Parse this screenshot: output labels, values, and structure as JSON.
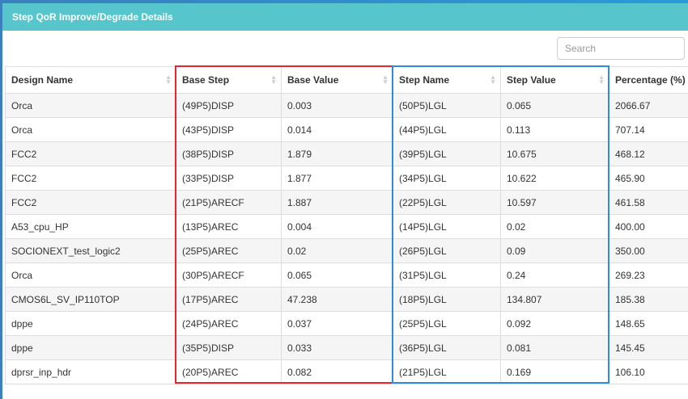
{
  "panel": {
    "title": "Step QoR Improve/Degrade Details"
  },
  "search": {
    "placeholder": "Search"
  },
  "columns": [
    "Design Name",
    "Base Step",
    "Base Value",
    "Step Name",
    "Step Value",
    "Percentage (%)"
  ],
  "rows": [
    [
      "Orca",
      "(49P5)DISP",
      "0.003",
      "(50P5)LGL",
      "0.065",
      "2066.67"
    ],
    [
      "Orca",
      "(43P5)DISP",
      "0.014",
      "(44P5)LGL",
      "0.113",
      "707.14"
    ],
    [
      "FCC2",
      "(38P5)DISP",
      "1.879",
      "(39P5)LGL",
      "10.675",
      "468.12"
    ],
    [
      "FCC2",
      "(33P5)DISP",
      "1.877",
      "(34P5)LGL",
      "10.622",
      "465.90"
    ],
    [
      "FCC2",
      "(21P5)ARECF",
      "1.887",
      "(22P5)LGL",
      "10.597",
      "461.58"
    ],
    [
      "A53_cpu_HP",
      "(13P5)AREC",
      "0.004",
      "(14P5)LGL",
      "0.02",
      "400.00"
    ],
    [
      "SOCIONEXT_test_logic2",
      "(25P5)AREC",
      "0.02",
      "(26P5)LGL",
      "0.09",
      "350.00"
    ],
    [
      "Orca",
      "(30P5)ARECF",
      "0.065",
      "(31P5)LGL",
      "0.24",
      "269.23"
    ],
    [
      "CMOS6L_SV_IP110TOP",
      "(17P5)AREC",
      "47.238",
      "(18P5)LGL",
      "134.807",
      "185.38"
    ],
    [
      "dppe",
      "(24P5)AREC",
      "0.037",
      "(25P5)LGL",
      "0.092",
      "148.65"
    ],
    [
      "dppe",
      "(35P5)DISP",
      "0.033",
      "(36P5)LGL",
      "0.081",
      "145.45"
    ],
    [
      "dprsr_inp_hdr",
      "(20P5)AREC",
      "0.082",
      "(21P5)LGL",
      "0.169",
      "106.10"
    ]
  ],
  "highlight_colors": {
    "base": "#e8262c",
    "step": "#2e8be0"
  }
}
